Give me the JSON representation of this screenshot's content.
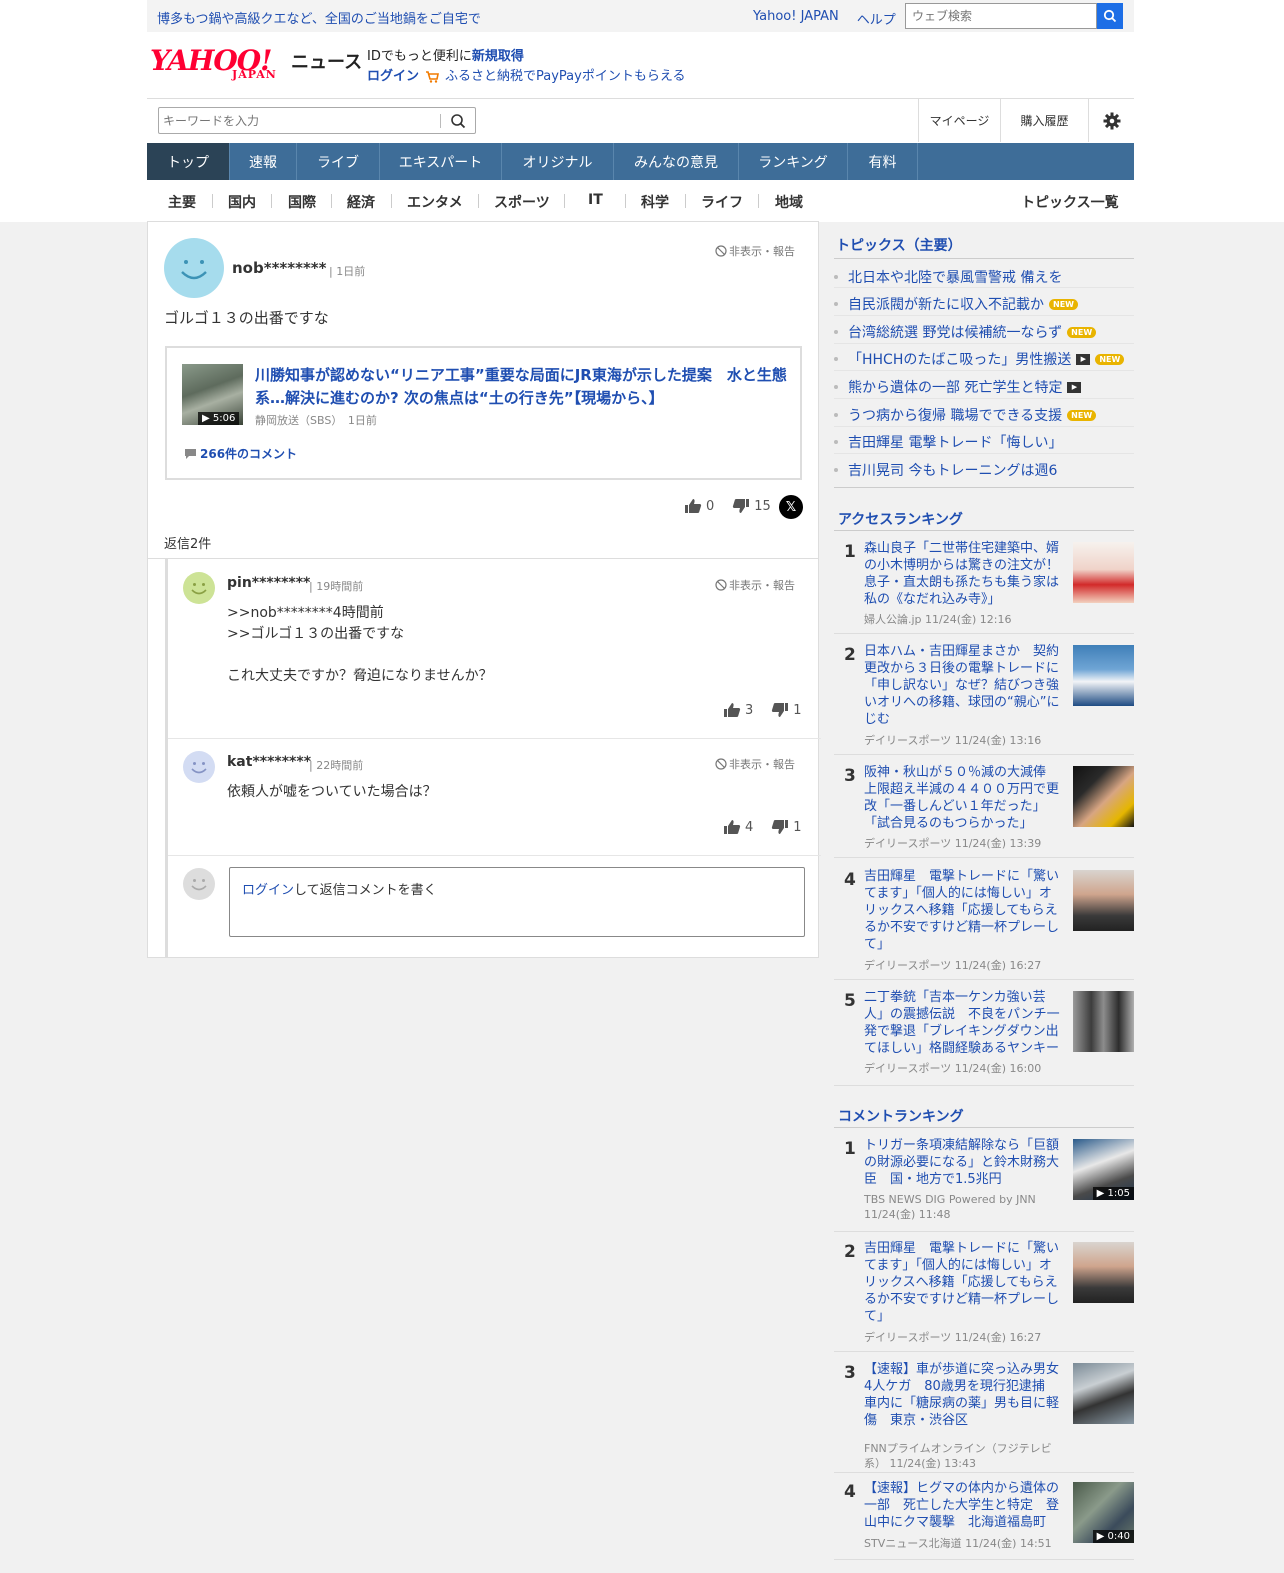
{
  "promo": {
    "text": "博多もつ鍋や高級クエなど、全国のご当地鍋をご自宅で"
  },
  "top_links": {
    "yahoo": "Yahoo! JAPAN",
    "help": "ヘルプ"
  },
  "top_search": {
    "placeholder": "ウェブ検索"
  },
  "logo": {
    "yahoo": "YAHOO!",
    "japan": "JAPAN",
    "news": "ニュース"
  },
  "id_promo": {
    "prefix": "IDでもっと便利に",
    "signup": "新規取得",
    "login": "ログイン",
    "furusato": "ふるさと納税でPayPayポイントもらえる"
  },
  "keyword_search": {
    "placeholder": "キーワードを入力"
  },
  "right_menu": {
    "mypage": "マイページ",
    "history": "購入履歴"
  },
  "main_nav": [
    "トップ",
    "速報",
    "ライブ",
    "エキスパート",
    "オリジナル",
    "みんなの意見",
    "ランキング",
    "有料"
  ],
  "sub_nav": [
    "主要",
    "国内",
    "国際",
    "経済",
    "エンタメ",
    "スポーツ",
    "IT",
    "科学",
    "ライフ",
    "地域"
  ],
  "sub_nav_all": "トピックス一覧",
  "comment": {
    "user": "nob********",
    "time": "1日前",
    "report": "非表示・報告",
    "text": "ゴルゴ１３の出番ですな",
    "article": {
      "title": "川勝知事が認めない“リニア工事”重要な局面にJR東海が示した提案　水と生態系…解決に進むのか? 次の焦点は“土の行き先”【現場から、】",
      "source": "静岡放送（SBS）",
      "time": "1日前",
      "duration": "▶ 5:06",
      "comments": "266件のコメント"
    },
    "likes": "0",
    "dislikes": "15",
    "x_label": "𝕏"
  },
  "replies_label": "返信2件",
  "replies": [
    {
      "user": "pin********",
      "time": "19時間前",
      "report": "非表示・報告",
      "text": ">>nob********4時間前\n>>ゴルゴ１３の出番ですな\n\nこれ大丈夫ですか？脅迫になりませんか？",
      "likes": "3",
      "dislikes": "1"
    },
    {
      "user": "kat********",
      "time": "22時間前",
      "report": "非表示・報告",
      "text": "依頼人が嘘をついていた場合は？",
      "likes": "4",
      "dislikes": "1"
    }
  ],
  "reply_input": {
    "login": "ログイン",
    "rest": "して返信コメントを書く"
  },
  "topics": {
    "title": "トピックス（主要）",
    "items": [
      {
        "text": "北日本や北陸で暴風雪警戒 備えを",
        "new": "",
        "video": false
      },
      {
        "text": "自民派閥が新たに収入不記載か",
        "new": "NEW",
        "video": false
      },
      {
        "text": "台湾総統選 野党は候補統一ならず",
        "new": "NEW",
        "video": false
      },
      {
        "text": "「HHCHのたばこ吸った」男性搬送",
        "new": "NEW",
        "video": true
      },
      {
        "text": "熊から遺体の一部 死亡学生と特定",
        "new": "",
        "video": true
      },
      {
        "text": "うつ病から復帰 職場でできる支援",
        "new": "NEW",
        "video": false
      },
      {
        "text": "吉田輝星 電撃トレード「悔しい」",
        "new": "",
        "video": false
      },
      {
        "text": "吉川晃司 今もトレーニングは週6",
        "new": "",
        "video": false
      }
    ]
  },
  "access_ranking": {
    "title": "アクセスランキング",
    "items": [
      {
        "rank": "1",
        "title": "森山良子「二世帯住宅建築中、婿の小木博明からは驚きの注文が！息子・直太朗も孫たちも集う家は私の《なだれ込み寺》」",
        "source": "婦人公論.jp 11/24(金) 12:16",
        "duration": ""
      },
      {
        "rank": "2",
        "title": "日本ハム・吉田輝星まさか　契約更改から３日後の電撃トレードに「申し訳ない」なぜ？結びつき強いオリへの移籍、球団の“親心”にじむ",
        "source": "デイリースポーツ 11/24(金) 13:16",
        "duration": ""
      },
      {
        "rank": "3",
        "title": "阪神・秋山が５０％減の大減俸　上限超え半減の４４００万円で更改「一番しんどい１年だった」「試合見るのもつらかった」",
        "source": "デイリースポーツ 11/24(金) 13:39",
        "duration": ""
      },
      {
        "rank": "4",
        "title": "吉田輝星　電撃トレードに「驚いてます」「個人的には悔しい」オリックスへ移籍「応援してもらえるか不安ですけど精一杯プレーして」",
        "source": "デイリースポーツ 11/24(金) 16:27",
        "duration": ""
      },
      {
        "rank": "5",
        "title": "二丁拳銃「吉本一ケンカ強い芸人」の震撼伝説　不良をパンチ一発で撃退「ブレイキングダウン出てほしい」格闘経験あるヤンキー",
        "source": "デイリースポーツ 11/24(金) 16:00",
        "duration": ""
      }
    ]
  },
  "comment_ranking": {
    "title": "コメントランキング",
    "items": [
      {
        "rank": "1",
        "title": "トリガー条項凍結解除なら「巨額の財源必要になる」と鈴木財務大臣　国・地方で1.5兆円",
        "source": "TBS NEWS DIG Powered by JNN 11/24(金) 11:48",
        "duration": "▶ 1:05"
      },
      {
        "rank": "2",
        "title": "吉田輝星　電撃トレードに「驚いてます」「個人的には悔しい」オリックスへ移籍「応援してもらえるか不安ですけど精一杯プレーして」",
        "source": "デイリースポーツ 11/24(金) 16:27",
        "duration": ""
      },
      {
        "rank": "3",
        "title": "【速報】車が歩道に突っ込み男女4人ケガ　80歳男を現行犯逮捕　車内に「糖尿病の薬」男も目に軽傷　東京・渋谷区",
        "source": "FNNプライムオンライン（フジテレビ系） 11/24(金) 13:43",
        "duration": ""
      },
      {
        "rank": "4",
        "title": "【速報】ヒグマの体内から遺体の一部　死亡した大学生と特定　登山中にクマ襲撃　北海道福島町",
        "source": "STVニュース北海道 11/24(金) 14:51",
        "duration": "▶ 0:40"
      }
    ]
  },
  "colors": {
    "link": "#1f4eb1",
    "nav": "#3e6d98",
    "nav_active": "#2b4356",
    "new_badge": "#e9b400"
  }
}
